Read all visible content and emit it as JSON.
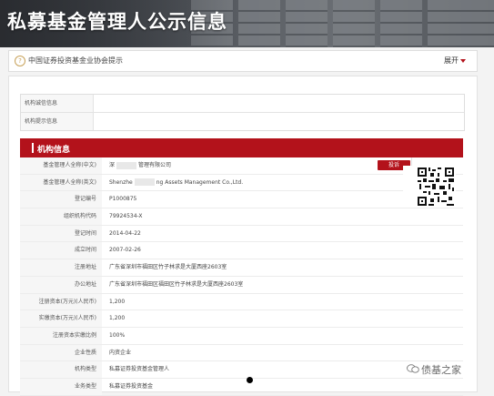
{
  "header": {
    "title": "私募基金管理人公示信息"
  },
  "notice": {
    "text": "中国证券投资基金业协会提示",
    "expand_label": "展开"
  },
  "top_fields": [
    {
      "label": "机构诚信信息",
      "value": ""
    },
    {
      "label": "机构提示信息",
      "value": ""
    }
  ],
  "section": {
    "title": "机构信息",
    "complain_label": "投诉"
  },
  "fields": [
    {
      "label": "基金管理人全称(中文)",
      "value_pre": "深",
      "value_post": "管理有限公司"
    },
    {
      "label": "基金管理人全称(英文)",
      "value_pre": "Shenzhe",
      "value_post": "ng Assets Management Co.,Ltd."
    },
    {
      "label": "登记编号",
      "value": "P1000875"
    },
    {
      "label": "组织机构代码",
      "value": "79924534-X"
    },
    {
      "label": "登记时间",
      "value": "2014-04-22"
    },
    {
      "label": "成立时间",
      "value": "2007-02-26"
    },
    {
      "label": "注册地址",
      "value": "广东省深圳市福田区竹子林求是大厦西座2603室"
    },
    {
      "label": "办公地址",
      "value": "广东省深圳市福田区福田区竹子林求是大厦西座2603室"
    },
    {
      "label": "注册资本(万元)(人民币)",
      "value": "1,200"
    },
    {
      "label": "实缴资本(万元)(人民币)",
      "value": "1,200"
    },
    {
      "label": "注册资本实缴比例",
      "value": "100%"
    },
    {
      "label": "企业性质",
      "value": "内资企业"
    },
    {
      "label": "机构类型",
      "value": "私募证券投资基金管理人"
    },
    {
      "label": "业务类型",
      "value": "私募证券投资基金"
    }
  ],
  "watermark": {
    "text": "债基之家"
  },
  "colors": {
    "brand_red": "#b3121b",
    "banner_dark": "#3a3e44"
  }
}
